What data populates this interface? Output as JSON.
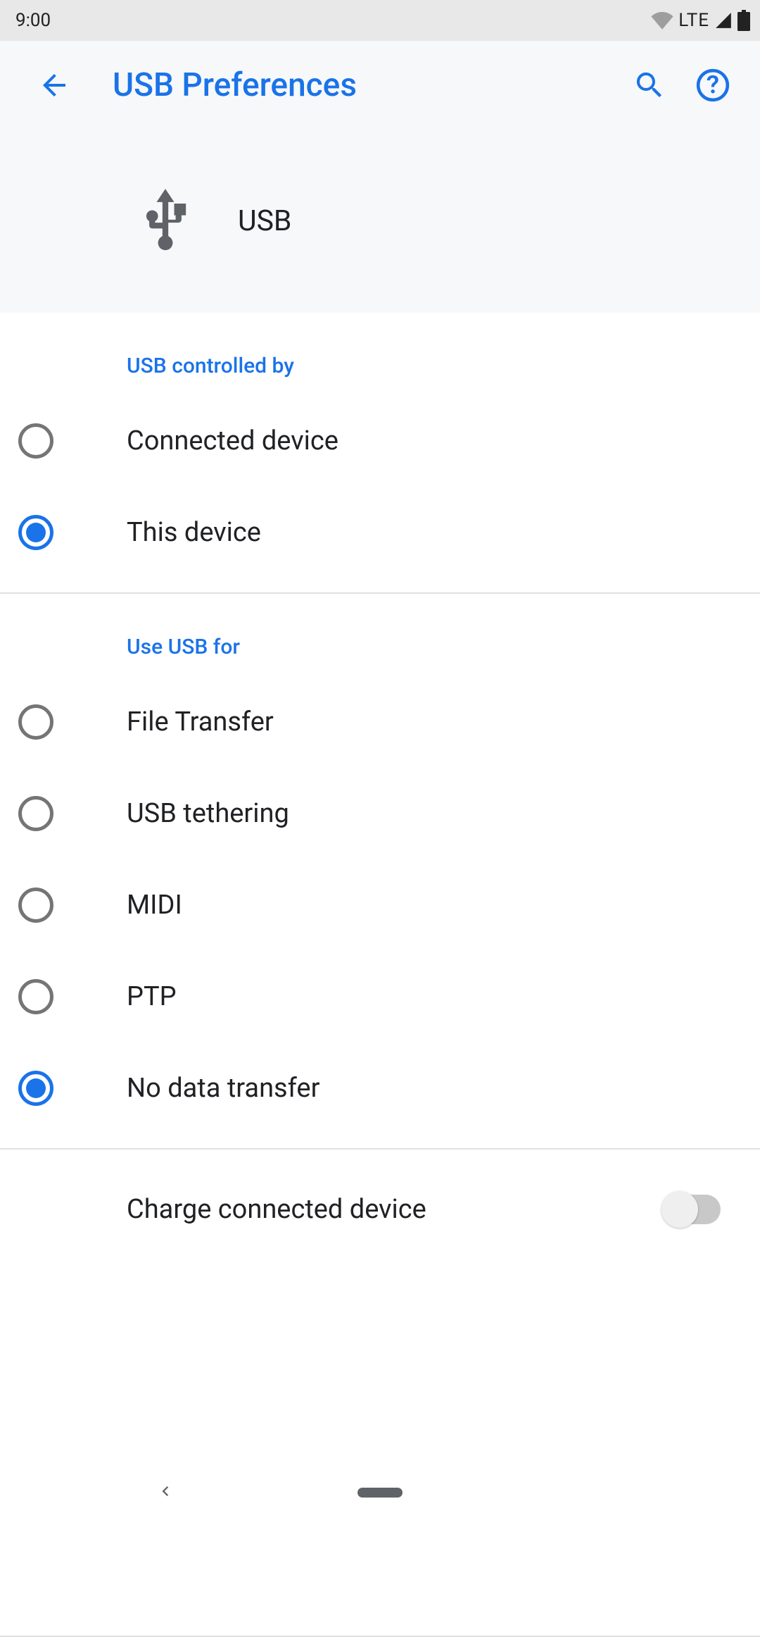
{
  "status": {
    "time": "9:00",
    "lte": "LTE"
  },
  "appbar": {
    "title": "USB Preferences"
  },
  "header": {
    "label": "USB"
  },
  "section1": {
    "title": "USB controlled by",
    "options": [
      {
        "label": "Connected device",
        "selected": false
      },
      {
        "label": "This device",
        "selected": true
      }
    ]
  },
  "section2": {
    "title": "Use USB for",
    "options": [
      {
        "label": "File Transfer",
        "selected": false
      },
      {
        "label": "USB tethering",
        "selected": false
      },
      {
        "label": "MIDI",
        "selected": false
      },
      {
        "label": "PTP",
        "selected": false
      },
      {
        "label": "No data transfer",
        "selected": true
      }
    ]
  },
  "toggle": {
    "label": "Charge connected device",
    "on": false
  }
}
